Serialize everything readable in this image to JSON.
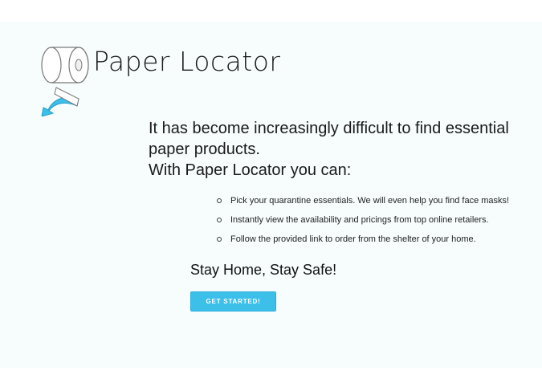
{
  "brand": {
    "name": "Paper Locator",
    "logo_icon": "toilet-paper-roll-arrow-icon",
    "accent": "#3cc0ea"
  },
  "headline": {
    "line1": "It has become increasingly difficult to find essential",
    "line2": "paper products.",
    "line3": "With Paper Locator you can:"
  },
  "features": [
    "Pick your quarantine essentials. We will even help you find face masks!",
    "Instantly view the availability and pricings from top online retailers.",
    "Follow the provided link to order from the shelter of your home."
  ],
  "tagline": "Stay Home, Stay Safe!",
  "cta": {
    "label": "GET STARTED!"
  }
}
